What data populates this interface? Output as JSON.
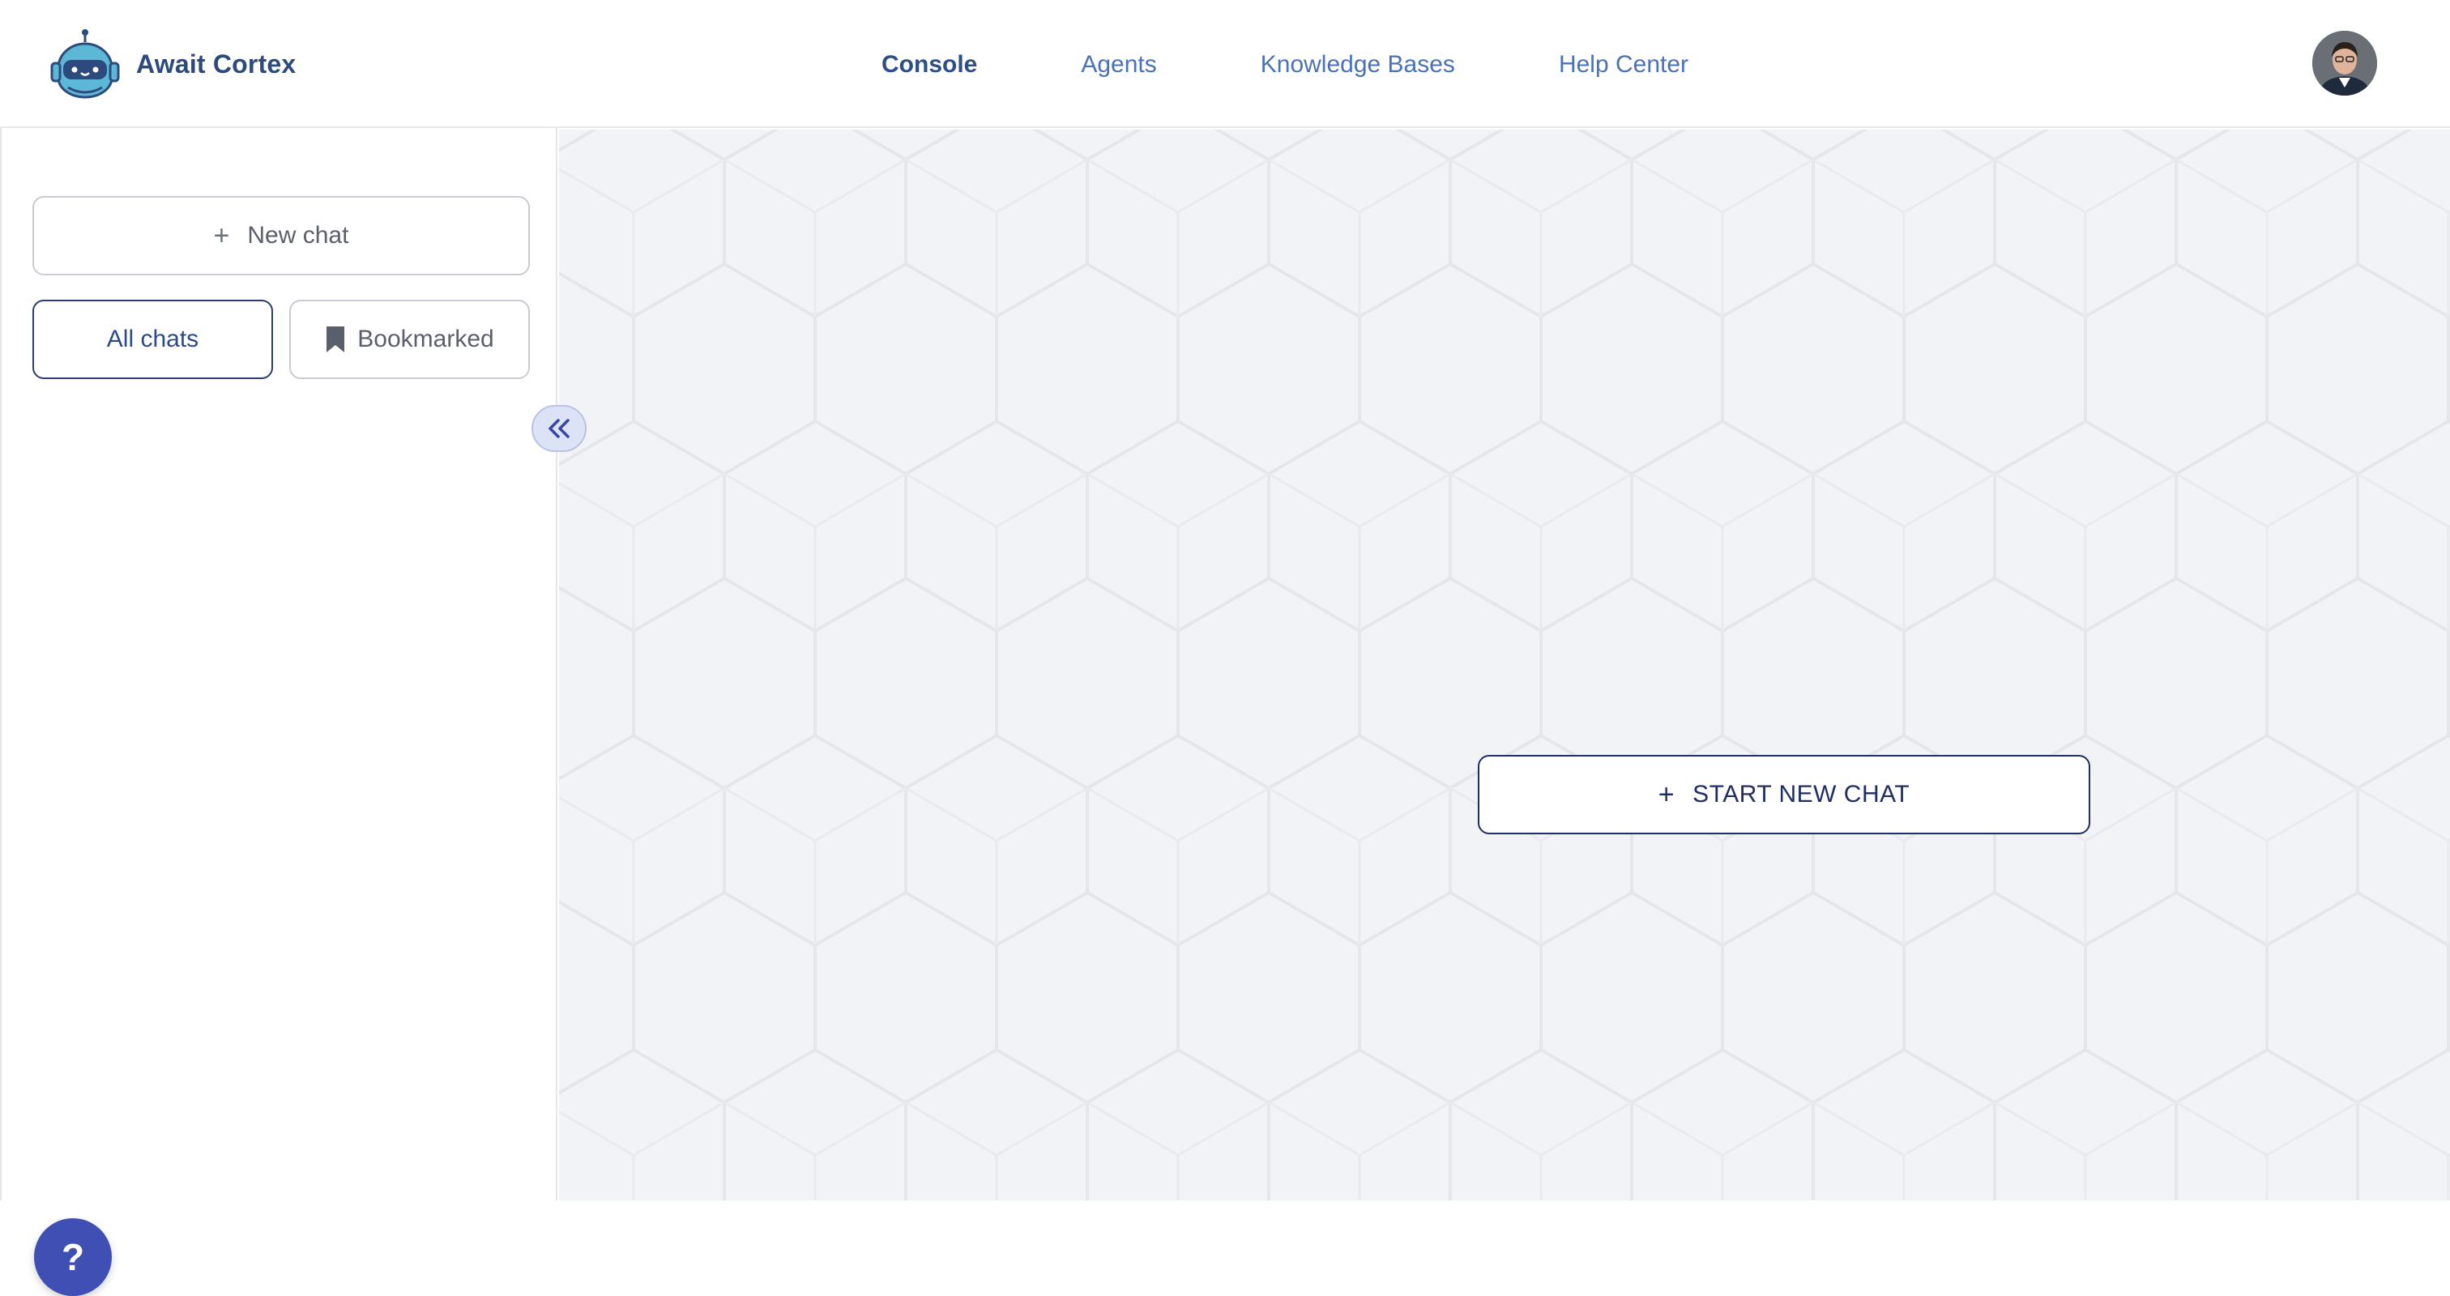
{
  "app": {
    "name": "Await Cortex",
    "logo_icon": "robot-logo-icon"
  },
  "nav": {
    "items": [
      {
        "label": "Console",
        "active": true
      },
      {
        "label": "Agents",
        "active": false
      },
      {
        "label": "Knowledge Bases",
        "active": false
      },
      {
        "label": "Help Center",
        "active": false
      }
    ]
  },
  "user": {
    "avatar_icon": "user-avatar"
  },
  "sidebar": {
    "new_chat_label": "New chat",
    "new_chat_icon": "plus",
    "tabs": {
      "all_label": "All chats",
      "bookmarked_label": "Bookmarked",
      "bookmarked_icon": "bookmark-icon",
      "active": "all"
    },
    "collapse_icon": "chevrons-left-icon",
    "help_label": "?"
  },
  "main": {
    "start_chat_label": "START NEW CHAT",
    "start_chat_icon": "plus"
  },
  "colors": {
    "brand_text": "#2d4a7c",
    "nav_link": "#4a72b5",
    "nav_active": "#2d4f88",
    "accent_dark": "#1f2f62",
    "help_button": "#3f4fb3",
    "background": "#f2f3f6"
  }
}
